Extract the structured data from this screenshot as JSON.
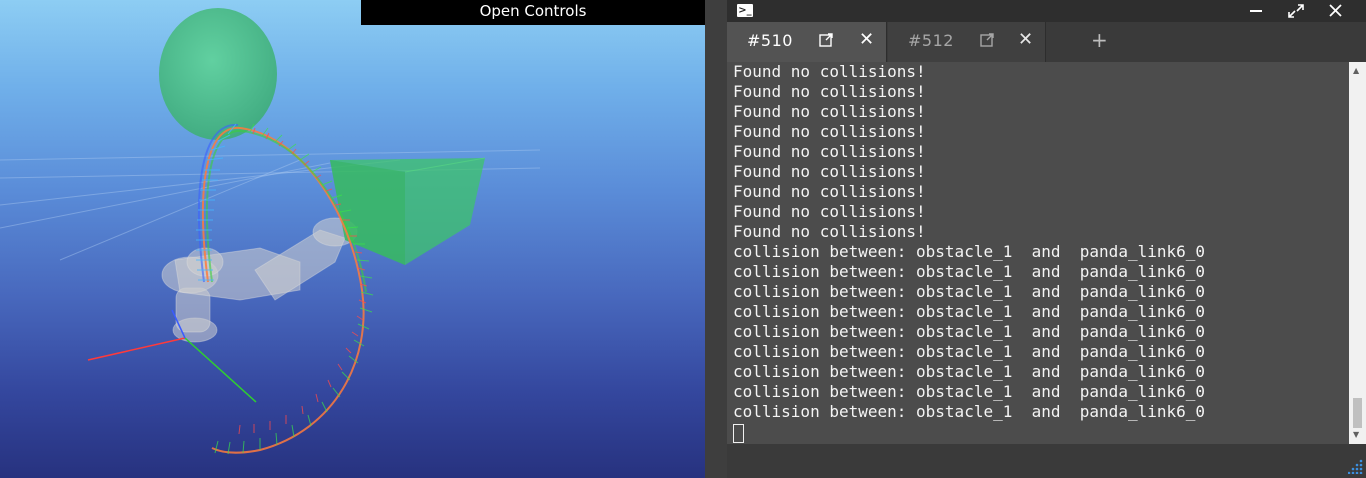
{
  "viewport": {
    "open_controls_label": "Open Controls"
  },
  "terminal": {
    "tabs": [
      {
        "label": "#510",
        "active": true
      },
      {
        "label": "#512",
        "active": false
      }
    ],
    "new_tab_label": "+",
    "lines": [
      "Found no collisions!",
      "Found no collisions!",
      "Found no collisions!",
      "Found no collisions!",
      "Found no collisions!",
      "Found no collisions!",
      "Found no collisions!",
      "Found no collisions!",
      "Found no collisions!",
      "collision between: obstacle_1  and  panda_link6_0",
      "collision between: obstacle_1  and  panda_link6_0",
      "collision between: obstacle_1  and  panda_link6_0",
      "collision between: obstacle_1  and  panda_link6_0",
      "collision between: obstacle_1  and  panda_link6_0",
      "collision between: obstacle_1  and  panda_link6_0",
      "collision between: obstacle_1  and  panda_link6_0",
      "collision between: obstacle_1  and  panda_link6_0",
      "collision between: obstacle_1  and  panda_link6_0"
    ],
    "scroll_position": 0.95
  },
  "icons": {
    "app": "terminal-icon",
    "minimize": "minimize-icon",
    "maximize": "maximize-icon",
    "close": "close-icon",
    "popout": "popout-icon",
    "tab_close": "close-icon",
    "resize": "resize-grip-icon"
  },
  "colors": {
    "sphere": "#4fc28b",
    "box": "#3cc46a",
    "robot": "#c9c9c9",
    "terminal_bg": "#4c4c4c",
    "terminal_text": "#f4f4f4"
  }
}
